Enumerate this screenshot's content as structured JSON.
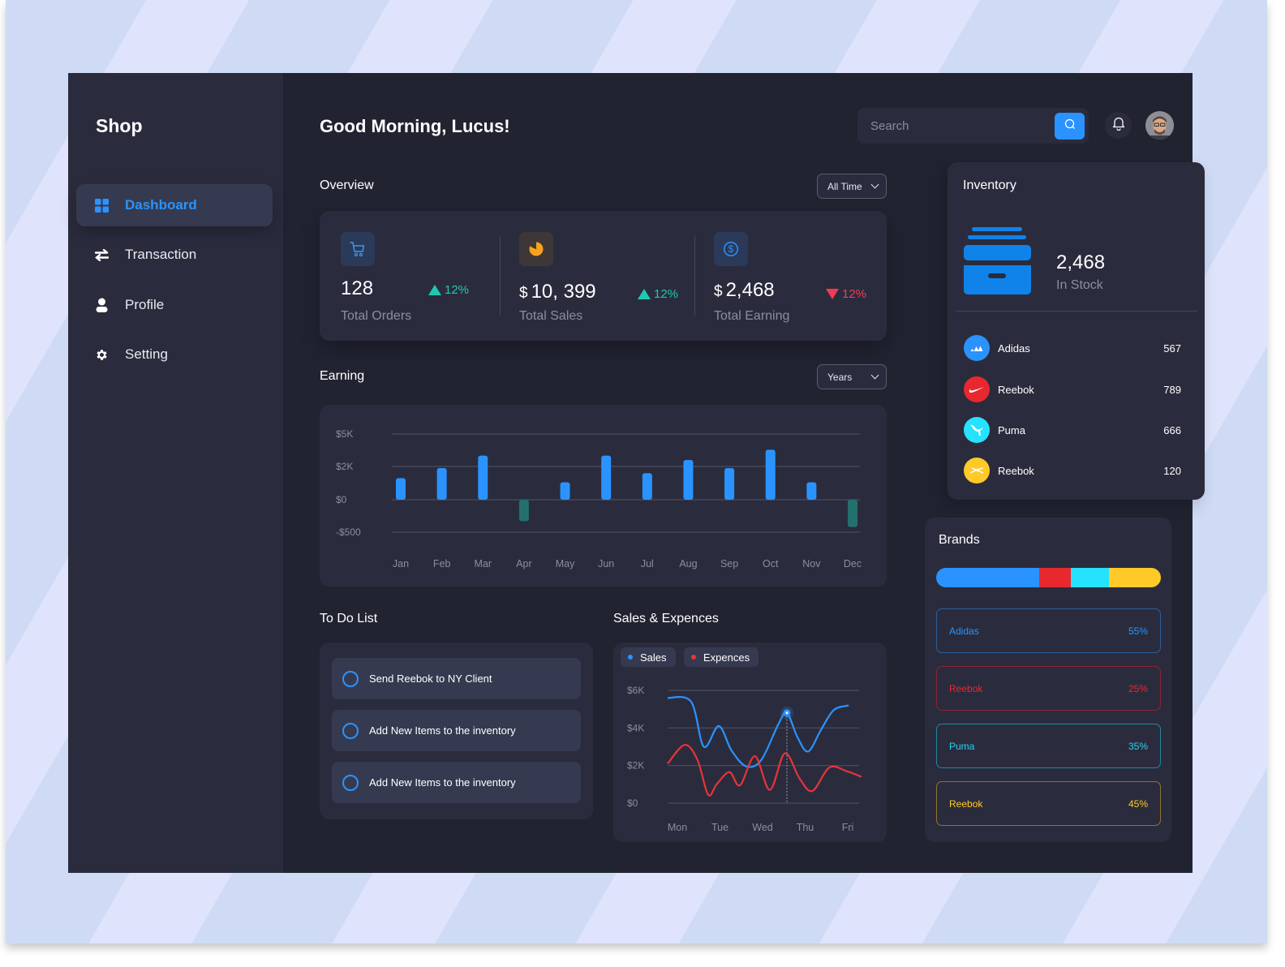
{
  "app": {
    "title": "Shop"
  },
  "sidebar": {
    "items": [
      {
        "label": "Dashboard",
        "icon": "grid-icon",
        "active": true
      },
      {
        "label": "Transaction",
        "icon": "swap-arrows-icon",
        "active": false
      },
      {
        "label": "Profile",
        "icon": "user-icon",
        "active": false
      },
      {
        "label": "Setting",
        "icon": "gear-icon",
        "active": false
      }
    ]
  },
  "header": {
    "greeting": "Good Morning, Lucus!",
    "search_placeholder": "Search",
    "search_value": ""
  },
  "overview": {
    "title": "Overview",
    "filter": "All Time",
    "stats": [
      {
        "icon": "cart-icon",
        "currency": "",
        "value": "128",
        "label": "Total Orders",
        "trend": "12%",
        "direction": "up"
      },
      {
        "icon": "pie-chart-icon",
        "currency": "$",
        "value": "10, 399",
        "label": "Total Sales",
        "trend": "12%",
        "direction": "up"
      },
      {
        "icon": "dollar-coin-icon",
        "currency": "$",
        "value": "2,468",
        "label": "Total Earning",
        "trend": "12%",
        "direction": "down"
      }
    ]
  },
  "earning": {
    "title": "Earning",
    "filter": "Years"
  },
  "chart_data": [
    {
      "type": "bar",
      "title": "Earning",
      "categories": [
        "Jan",
        "Feb",
        "Mar",
        "Apr",
        "May",
        "Jun",
        "Jul",
        "Aug",
        "Sep",
        "Oct",
        "Nov",
        "Dec"
      ],
      "values": [
        1300,
        1900,
        3000,
        -330,
        1050,
        3000,
        1600,
        2600,
        1900,
        3550,
        1050,
        -420
      ],
      "y_tick_labels": [
        "$5K",
        "$2K",
        "$0",
        "-$500"
      ],
      "xlabel": "",
      "ylabel": "",
      "colors": {
        "positive": "#2a93ff",
        "negative": "#23716f"
      },
      "grid": true
    },
    {
      "type": "line",
      "title": "Sales & Expences",
      "x": [
        "Mon",
        "Tue",
        "Wed",
        "Thu",
        "Fri"
      ],
      "y_tick_labels": [
        "$6K",
        "$4K",
        "$2K",
        "$0"
      ],
      "ylim": [
        0,
        6000
      ],
      "series": [
        {
          "name": "Sales",
          "color": "#2a93ff",
          "points": [
            [
              0.0,
              5600
            ],
            [
              0.55,
              5400
            ],
            [
              0.85,
              3000
            ],
            [
              1.2,
              4100
            ],
            [
              1.5,
              2800
            ],
            [
              1.85,
              1950
            ],
            [
              2.2,
              2300
            ],
            [
              2.6,
              4200
            ],
            [
              2.8,
              4800
            ],
            [
              3.05,
              3500
            ],
            [
              3.3,
              2750
            ],
            [
              3.6,
              3900
            ],
            [
              3.9,
              4950
            ],
            [
              4.25,
              5200
            ]
          ]
        },
        {
          "name": "Expences",
          "color": "#e8333a",
          "points": [
            [
              0.0,
              2100
            ],
            [
              0.4,
              3100
            ],
            [
              0.7,
              2300
            ],
            [
              0.95,
              450
            ],
            [
              1.15,
              1000
            ],
            [
              1.45,
              1650
            ],
            [
              1.7,
              950
            ],
            [
              2.05,
              2500
            ],
            [
              2.4,
              700
            ],
            [
              2.75,
              2650
            ],
            [
              3.1,
              1300
            ],
            [
              3.4,
              650
            ],
            [
              3.8,
              1900
            ],
            [
              4.2,
              1700
            ],
            [
              4.55,
              1400
            ]
          ]
        }
      ],
      "highlight": {
        "series": "Sales",
        "x": 2.8,
        "value": 4800
      },
      "grid": true,
      "legend": "top-left"
    }
  ],
  "todo": {
    "title": "To Do List",
    "items": [
      {
        "text": "Send Reebok to NY Client",
        "done": false
      },
      {
        "text": "Add New Items to the inventory",
        "done": false
      },
      {
        "text": "Add New Items to the inventory",
        "done": false
      }
    ]
  },
  "sales_expenses": {
    "title": "Sales & Expences",
    "legend": [
      {
        "label": "Sales",
        "color": "#2a93ff"
      },
      {
        "label": "Expences",
        "color": "#e8333a"
      }
    ]
  },
  "inventory": {
    "title": "Inventory",
    "in_stock_value": "2,468",
    "in_stock_label": "In Stock",
    "items": [
      {
        "name": "Adidas",
        "count": "567",
        "logo": "adidas-logo-icon",
        "color": "#2a93ff"
      },
      {
        "name": "Reebok",
        "count": "789",
        "logo": "nike-swoosh-icon",
        "color": "#e8282f"
      },
      {
        "name": "Puma",
        "count": "666",
        "logo": "puma-cat-icon",
        "color": "#25e2ff"
      },
      {
        "name": "Reebok",
        "count": "120",
        "logo": "reebok-delta-icon",
        "color": "#ffca28"
      }
    ]
  },
  "brands": {
    "title": "Brands",
    "share_bar": [
      {
        "name": "Adidas",
        "fraction": 0.46,
        "color": "#2a93ff"
      },
      {
        "name": "Reebok",
        "fraction": 0.14,
        "color": "#e8282f"
      },
      {
        "name": "Puma",
        "fraction": 0.17,
        "color": "#25e2ff"
      },
      {
        "name": "Reebok",
        "fraction": 0.23,
        "color": "#ffca28"
      }
    ],
    "items": [
      {
        "name": "Adidas",
        "percent": "55%",
        "color": "#2a93ff",
        "border": "#2a5f9e"
      },
      {
        "name": "Reebok",
        "percent": "25%",
        "color": "#e8282f",
        "border": "#8a2430"
      },
      {
        "name": "Puma",
        "percent": "35%",
        "color": "#25d4f0",
        "border": "#23869c"
      },
      {
        "name": "Reebok",
        "percent": "45%",
        "color": "#ffca28",
        "border": "#8c7430"
      }
    ]
  }
}
